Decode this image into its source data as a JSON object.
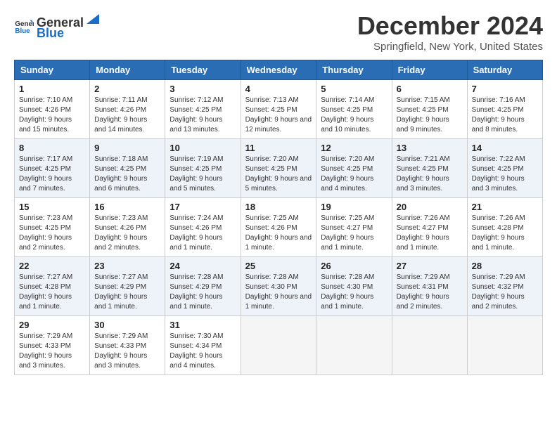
{
  "logo": {
    "general": "General",
    "blue": "Blue"
  },
  "title": "December 2024",
  "location": "Springfield, New York, United States",
  "days_of_week": [
    "Sunday",
    "Monday",
    "Tuesday",
    "Wednesday",
    "Thursday",
    "Friday",
    "Saturday"
  ],
  "weeks": [
    [
      {
        "day": "1",
        "sunrise": "7:10 AM",
        "sunset": "4:26 PM",
        "daylight": "9 hours and 15 minutes."
      },
      {
        "day": "2",
        "sunrise": "7:11 AM",
        "sunset": "4:26 PM",
        "daylight": "9 hours and 14 minutes."
      },
      {
        "day": "3",
        "sunrise": "7:12 AM",
        "sunset": "4:25 PM",
        "daylight": "9 hours and 13 minutes."
      },
      {
        "day": "4",
        "sunrise": "7:13 AM",
        "sunset": "4:25 PM",
        "daylight": "9 hours and 12 minutes."
      },
      {
        "day": "5",
        "sunrise": "7:14 AM",
        "sunset": "4:25 PM",
        "daylight": "9 hours and 10 minutes."
      },
      {
        "day": "6",
        "sunrise": "7:15 AM",
        "sunset": "4:25 PM",
        "daylight": "9 hours and 9 minutes."
      },
      {
        "day": "7",
        "sunrise": "7:16 AM",
        "sunset": "4:25 PM",
        "daylight": "9 hours and 8 minutes."
      }
    ],
    [
      {
        "day": "8",
        "sunrise": "7:17 AM",
        "sunset": "4:25 PM",
        "daylight": "9 hours and 7 minutes."
      },
      {
        "day": "9",
        "sunrise": "7:18 AM",
        "sunset": "4:25 PM",
        "daylight": "9 hours and 6 minutes."
      },
      {
        "day": "10",
        "sunrise": "7:19 AM",
        "sunset": "4:25 PM",
        "daylight": "9 hours and 5 minutes."
      },
      {
        "day": "11",
        "sunrise": "7:20 AM",
        "sunset": "4:25 PM",
        "daylight": "9 hours and 5 minutes."
      },
      {
        "day": "12",
        "sunrise": "7:20 AM",
        "sunset": "4:25 PM",
        "daylight": "9 hours and 4 minutes."
      },
      {
        "day": "13",
        "sunrise": "7:21 AM",
        "sunset": "4:25 PM",
        "daylight": "9 hours and 3 minutes."
      },
      {
        "day": "14",
        "sunrise": "7:22 AM",
        "sunset": "4:25 PM",
        "daylight": "9 hours and 3 minutes."
      }
    ],
    [
      {
        "day": "15",
        "sunrise": "7:23 AM",
        "sunset": "4:25 PM",
        "daylight": "9 hours and 2 minutes."
      },
      {
        "day": "16",
        "sunrise": "7:23 AM",
        "sunset": "4:26 PM",
        "daylight": "9 hours and 2 minutes."
      },
      {
        "day": "17",
        "sunrise": "7:24 AM",
        "sunset": "4:26 PM",
        "daylight": "9 hours and 1 minute."
      },
      {
        "day": "18",
        "sunrise": "7:25 AM",
        "sunset": "4:26 PM",
        "daylight": "9 hours and 1 minute."
      },
      {
        "day": "19",
        "sunrise": "7:25 AM",
        "sunset": "4:27 PM",
        "daylight": "9 hours and 1 minute."
      },
      {
        "day": "20",
        "sunrise": "7:26 AM",
        "sunset": "4:27 PM",
        "daylight": "9 hours and 1 minute."
      },
      {
        "day": "21",
        "sunrise": "7:26 AM",
        "sunset": "4:28 PM",
        "daylight": "9 hours and 1 minute."
      }
    ],
    [
      {
        "day": "22",
        "sunrise": "7:27 AM",
        "sunset": "4:28 PM",
        "daylight": "9 hours and 1 minute."
      },
      {
        "day": "23",
        "sunrise": "7:27 AM",
        "sunset": "4:29 PM",
        "daylight": "9 hours and 1 minute."
      },
      {
        "day": "24",
        "sunrise": "7:28 AM",
        "sunset": "4:29 PM",
        "daylight": "9 hours and 1 minute."
      },
      {
        "day": "25",
        "sunrise": "7:28 AM",
        "sunset": "4:30 PM",
        "daylight": "9 hours and 1 minute."
      },
      {
        "day": "26",
        "sunrise": "7:28 AM",
        "sunset": "4:30 PM",
        "daylight": "9 hours and 1 minute."
      },
      {
        "day": "27",
        "sunrise": "7:29 AM",
        "sunset": "4:31 PM",
        "daylight": "9 hours and 2 minutes."
      },
      {
        "day": "28",
        "sunrise": "7:29 AM",
        "sunset": "4:32 PM",
        "daylight": "9 hours and 2 minutes."
      }
    ],
    [
      {
        "day": "29",
        "sunrise": "7:29 AM",
        "sunset": "4:33 PM",
        "daylight": "9 hours and 3 minutes."
      },
      {
        "day": "30",
        "sunrise": "7:29 AM",
        "sunset": "4:33 PM",
        "daylight": "9 hours and 3 minutes."
      },
      {
        "day": "31",
        "sunrise": "7:30 AM",
        "sunset": "4:34 PM",
        "daylight": "9 hours and 4 minutes."
      },
      null,
      null,
      null,
      null
    ]
  ]
}
